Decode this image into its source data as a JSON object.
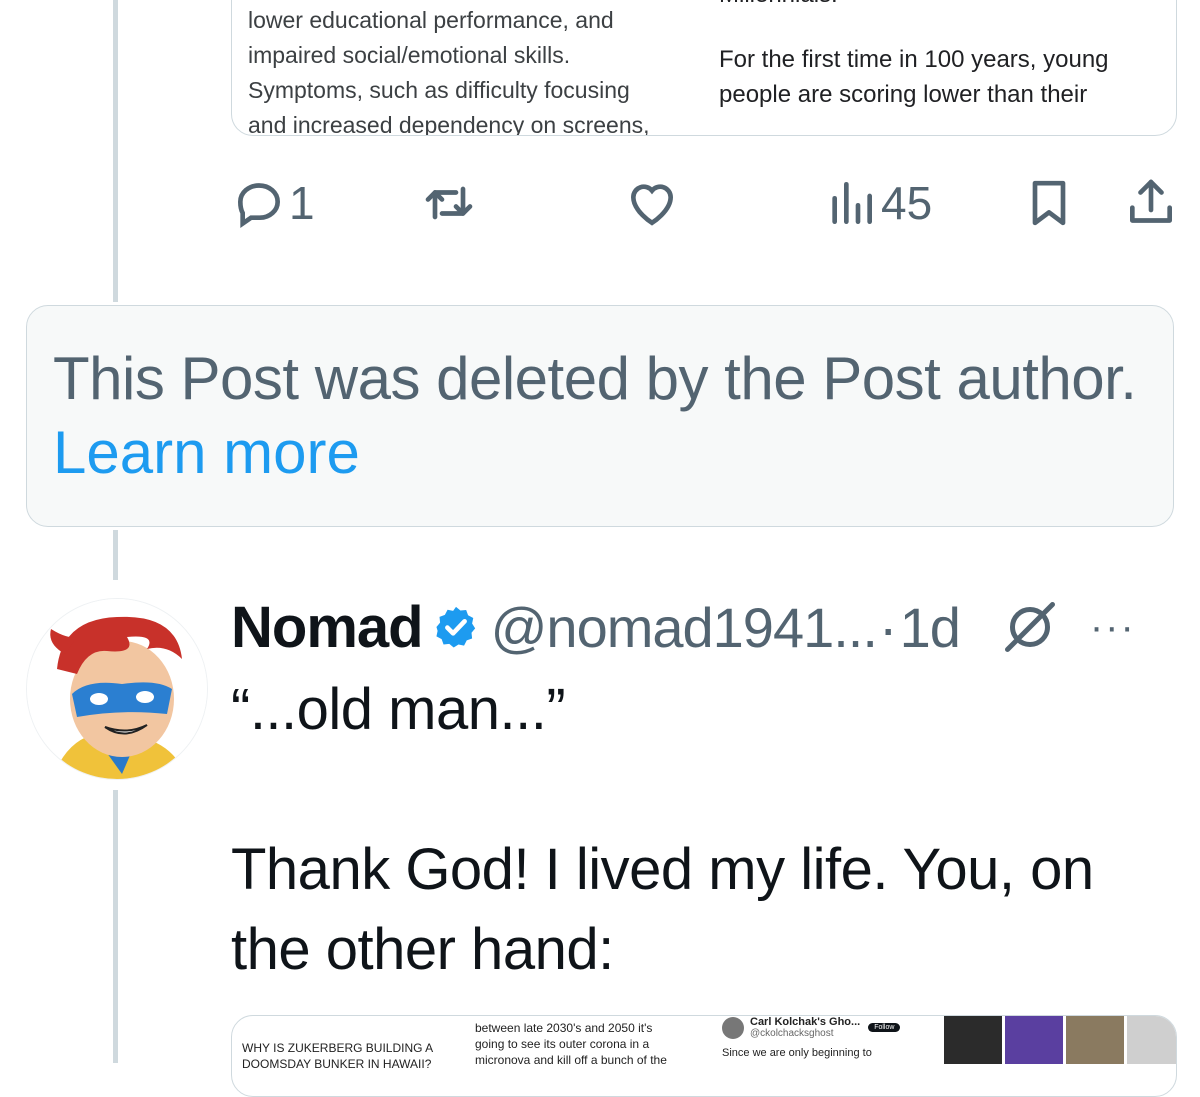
{
  "previous_post": {
    "quoted_card": {
      "left_lines": [
        "lower educational performance, and",
        "impaired social/emotional skills.",
        "Symptoms, such as difficulty focusing",
        "and increased dependency on screens,"
      ],
      "right_top": "Millennials.",
      "right_lines": [
        "For the first time in 100 years, young",
        "people are scoring lower than their"
      ]
    },
    "actions": {
      "reply_count": "1",
      "repost_count": "",
      "like_count": "",
      "views_count": "45"
    }
  },
  "deleted_notice": {
    "message": "This Post was deleted by the Post author.",
    "link_label": "Learn more"
  },
  "post": {
    "author_name": "Nomad",
    "handle": "@nomad1941...",
    "separator": "·",
    "time": "1d",
    "more_label": "···",
    "text": "“...old man...”\n\nThank God! I lived my life. You, on the other hand:",
    "media": {
      "col1_lines": [
        "WHY IS ZUKERBERG BUILDING A",
        "DOOMSDAY BUNKER IN HAWAII?"
      ],
      "col2_lines": [
        "between late 2030's and 2050 it's",
        "going to see its outer corona in a",
        "micronova and kill off a bunch of the"
      ],
      "col3_name": "Carl Kolchak's Gho...",
      "col3_handle": "@ckolchacksghost",
      "col3_follow": "Follow",
      "col3_body": "Since we are only beginning to"
    }
  },
  "colors": {
    "accent": "#1d9bf0",
    "secondary_text": "#536471",
    "border": "#cfd9de",
    "notice_bg": "#f7f9f9"
  }
}
